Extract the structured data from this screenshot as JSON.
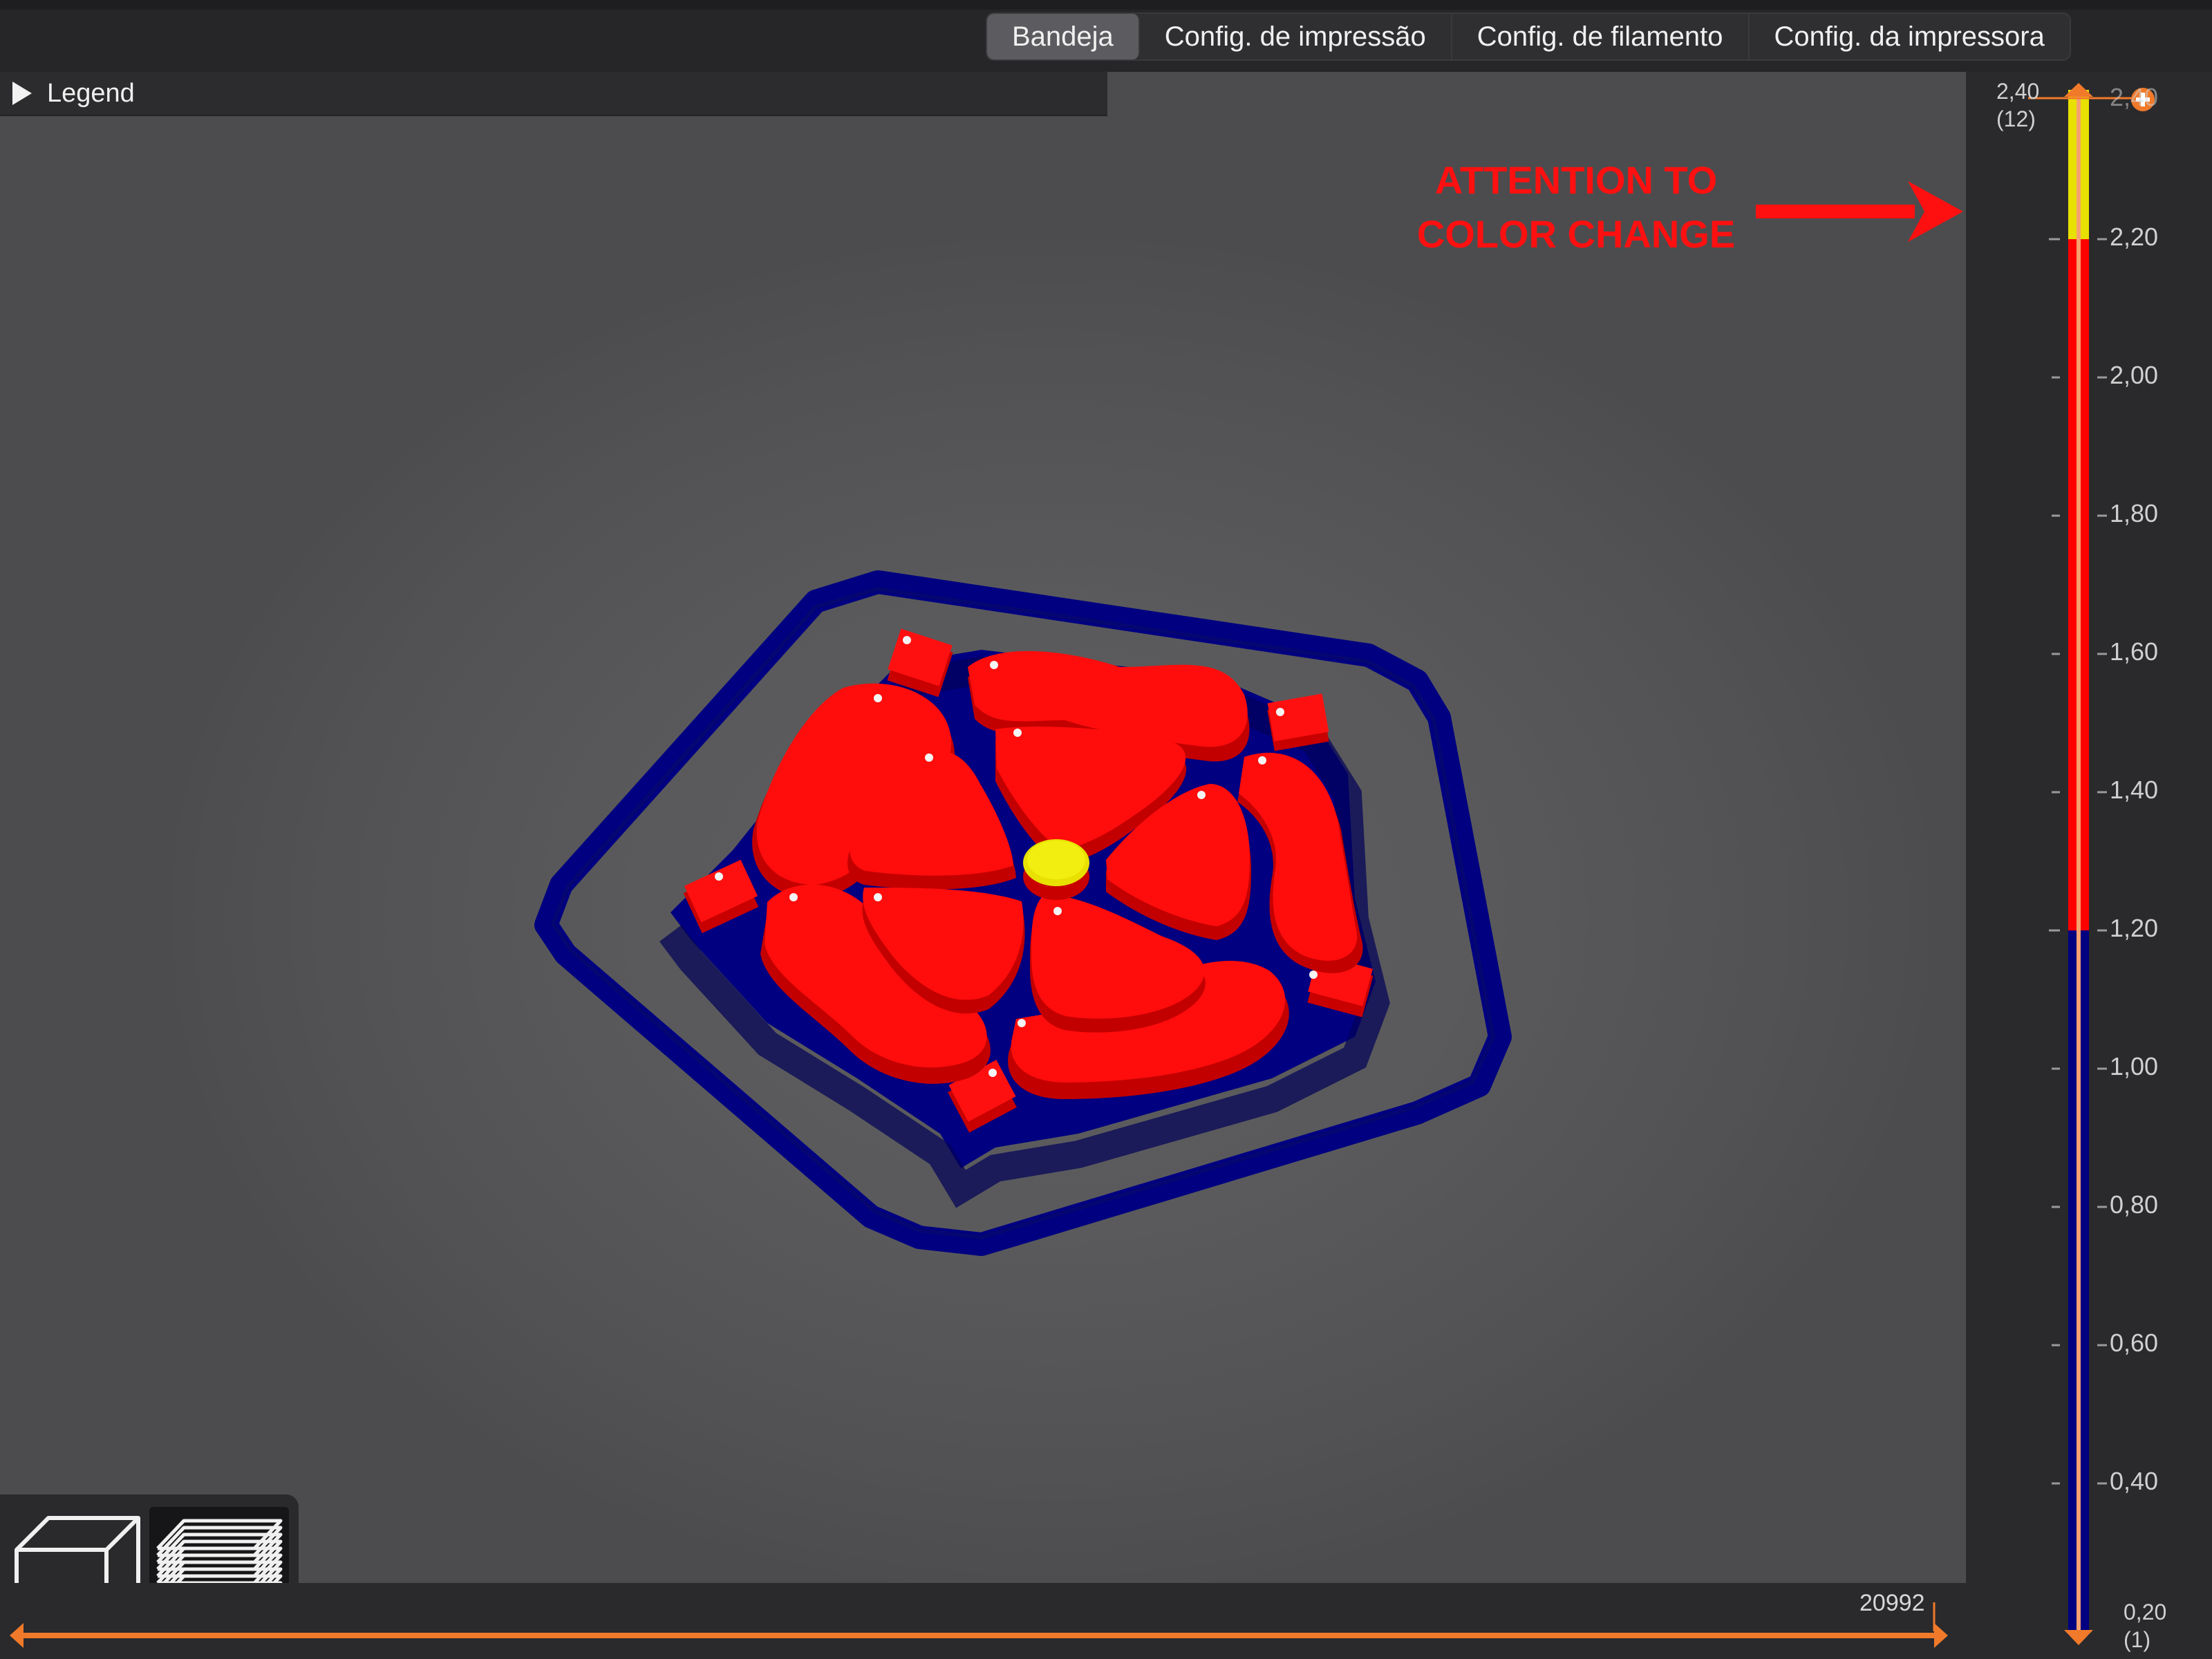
{
  "tabs": [
    {
      "label": "Bandeja",
      "active": true
    },
    {
      "label": "Config. de impressão",
      "active": false
    },
    {
      "label": "Config. de filamento",
      "active": false
    },
    {
      "label": "Config. da impressora",
      "active": false
    }
  ],
  "legend": {
    "label": "Legend",
    "expanded": false
  },
  "annotation": {
    "line1": "ATTENTION TO",
    "line2": "COLOR CHANGE"
  },
  "horizontal_slider": {
    "value": "20992"
  },
  "vertical_slider": {
    "top_value": "2,40",
    "top_layer": "(12)",
    "bottom_value": "0,20",
    "bottom_layer": "(1)",
    "ticks": [
      "2,20",
      "2,00",
      "1,80",
      "1,60",
      "1,40",
      "1,20",
      "1,00",
      "0,80",
      "0,60",
      "0,40"
    ],
    "top_tick_partial": "2,40",
    "segments": [
      {
        "color": "#e8e000",
        "from": "2,20",
        "to": "2,40"
      },
      {
        "color": "#ff0000",
        "from": "1,20",
        "to": "2,20"
      },
      {
        "color": "#000080",
        "from": "0,20",
        "to": "1,20"
      }
    ]
  },
  "colors": {
    "accent": "#f07a2a",
    "filament_base": "#000080",
    "filament_petals": "#ff0000",
    "filament_center": "#e8e000",
    "annotation": "#ff1010"
  },
  "icons": {
    "view_3d": "cube-icon",
    "view_layers": "layers-icon",
    "add_color_change": "plus-circle-icon"
  }
}
